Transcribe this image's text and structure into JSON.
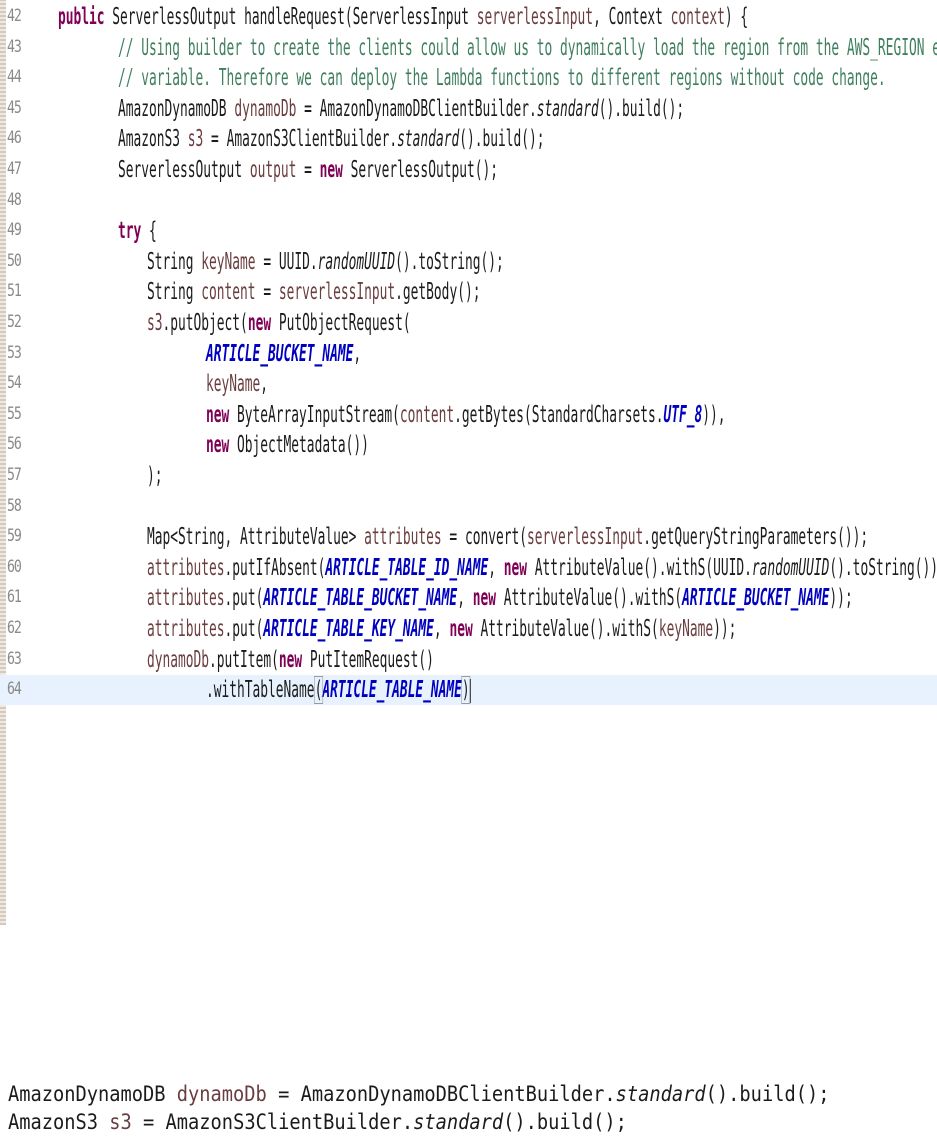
{
  "editor": {
    "lines": [
      {
        "num": "42",
        "tokens": [
          {
            "t": "public",
            "c": "kw"
          },
          {
            "t": " ServerlessOutput handleRequest(ServerlessInput "
          },
          {
            "t": "serverlessInput",
            "c": "var"
          },
          {
            "t": ", Context "
          },
          {
            "t": "context",
            "c": "var"
          },
          {
            "t": ") {"
          }
        ]
      },
      {
        "num": "43",
        "tokens": [
          {
            "t": "// Using builder to create the clients could allow us to dynamically load the region from the AWS_REGION envi",
            "c": "cm"
          }
        ]
      },
      {
        "num": "44",
        "tokens": [
          {
            "t": "// variable. Therefore we can deploy the Lambda functions to different regions without code change.",
            "c": "cm"
          }
        ]
      },
      {
        "num": "45",
        "tokens": [
          {
            "t": "AmazonDynamoDB "
          },
          {
            "t": "dynamoDb",
            "c": "var"
          },
          {
            "t": " = AmazonDynamoDBClientBuilder."
          },
          {
            "t": "standard",
            "c": "it"
          },
          {
            "t": "().build();"
          }
        ]
      },
      {
        "num": "46",
        "tokens": [
          {
            "t": "AmazonS3 "
          },
          {
            "t": "s3",
            "c": "var"
          },
          {
            "t": " = AmazonS3ClientBuilder."
          },
          {
            "t": "standard",
            "c": "it"
          },
          {
            "t": "().build();"
          }
        ]
      },
      {
        "num": "47",
        "tokens": [
          {
            "t": "ServerlessOutput "
          },
          {
            "t": "output",
            "c": "var"
          },
          {
            "t": " = "
          },
          {
            "t": "new",
            "c": "kw"
          },
          {
            "t": " ServerlessOutput();"
          }
        ]
      },
      {
        "num": "48",
        "tokens": []
      },
      {
        "num": "49",
        "tokens": [
          {
            "t": "try",
            "c": "kw"
          },
          {
            "t": " {"
          }
        ]
      },
      {
        "num": "50",
        "tokens": [
          {
            "t": "String "
          },
          {
            "t": "keyName",
            "c": "var"
          },
          {
            "t": " = UUID."
          },
          {
            "t": "randomUUID",
            "c": "it"
          },
          {
            "t": "().toString();"
          }
        ]
      },
      {
        "num": "51",
        "tokens": [
          {
            "t": "String "
          },
          {
            "t": "content",
            "c": "var"
          },
          {
            "t": " = "
          },
          {
            "t": "serverlessInput",
            "c": "var"
          },
          {
            "t": ".getBody();"
          }
        ]
      },
      {
        "num": "52",
        "tokens": [
          {
            "t": "s3",
            "c": "var"
          },
          {
            "t": ".putObject("
          },
          {
            "t": "new",
            "c": "kw"
          },
          {
            "t": " PutObjectRequest("
          }
        ]
      },
      {
        "num": "53",
        "tokens": [
          {
            "t": "ARTICLE_BUCKET_NAME",
            "c": "fld"
          },
          {
            "t": ","
          }
        ]
      },
      {
        "num": "54",
        "tokens": [
          {
            "t": "keyName",
            "c": "var"
          },
          {
            "t": ","
          }
        ]
      },
      {
        "num": "55",
        "tokens": [
          {
            "t": "new",
            "c": "kw"
          },
          {
            "t": " ByteArrayInputStream("
          },
          {
            "t": "content",
            "c": "var"
          },
          {
            "t": ".getBytes(StandardCharsets."
          },
          {
            "t": "UTF_8",
            "c": "fld"
          },
          {
            "t": ")),"
          }
        ]
      },
      {
        "num": "56",
        "tokens": [
          {
            "t": "new",
            "c": "kw"
          },
          {
            "t": " ObjectMetadata())"
          }
        ]
      },
      {
        "num": "57",
        "tokens": [
          {
            "t": ");"
          }
        ]
      },
      {
        "num": "58",
        "tokens": []
      },
      {
        "num": "59",
        "tokens": [
          {
            "t": "Map<String, AttributeValue> "
          },
          {
            "t": "attributes",
            "c": "var"
          },
          {
            "t": " = convert("
          },
          {
            "t": "serverlessInput",
            "c": "var"
          },
          {
            "t": ".getQueryStringParameters());"
          }
        ]
      },
      {
        "num": "60",
        "tokens": [
          {
            "t": "attributes",
            "c": "var"
          },
          {
            "t": ".putIfAbsent("
          },
          {
            "t": "ARTICLE_TABLE_ID_NAME",
            "c": "fld"
          },
          {
            "t": ", "
          },
          {
            "t": "new",
            "c": "kw"
          },
          {
            "t": " AttributeValue().withS(UUID."
          },
          {
            "t": "randomUUID",
            "c": "it"
          },
          {
            "t": "().toString()));"
          }
        ]
      },
      {
        "num": "61",
        "tokens": [
          {
            "t": "attributes",
            "c": "var"
          },
          {
            "t": ".put("
          },
          {
            "t": "ARTICLE_TABLE_BUCKET_NAME",
            "c": "fld"
          },
          {
            "t": ", "
          },
          {
            "t": "new",
            "c": "kw"
          },
          {
            "t": " AttributeValue().withS("
          },
          {
            "t": "ARTICLE_BUCKET_NAME",
            "c": "fld"
          },
          {
            "t": "));"
          }
        ]
      },
      {
        "num": "62",
        "tokens": [
          {
            "t": "attributes",
            "c": "var"
          },
          {
            "t": ".put("
          },
          {
            "t": "ARTICLE_TABLE_KEY_NAME",
            "c": "fld"
          },
          {
            "t": ", "
          },
          {
            "t": "new",
            "c": "kw"
          },
          {
            "t": " AttributeValue().withS("
          },
          {
            "t": "keyName",
            "c": "var"
          },
          {
            "t": "));"
          }
        ]
      },
      {
        "num": "63",
        "tokens": [
          {
            "t": "dynamoDb",
            "c": "var"
          },
          {
            "t": ".putItem("
          },
          {
            "t": "new",
            "c": "kw"
          },
          {
            "t": " PutItemRequest()"
          }
        ]
      },
      {
        "num": "64",
        "tokens": [
          {
            "t": ".withTableName"
          },
          {
            "t": "(",
            "c": "bracket"
          },
          {
            "t": "ARTICLE_TABLE_NAME",
            "c": "fld"
          },
          {
            "t": ")",
            "c": "bracket"
          }
        ]
      }
    ]
  },
  "snippet": {
    "lines": [
      {
        "tokens": [
          {
            "t": "AmazonDynamoDB "
          },
          {
            "t": "dynamoDb",
            "c": "var"
          },
          {
            "t": " = AmazonDynamoDBClientBuilder."
          },
          {
            "t": "standard",
            "c": "it"
          },
          {
            "t": "().build();"
          }
        ]
      },
      {
        "tokens": [
          {
            "t": "AmazonS3 "
          },
          {
            "t": "s3",
            "c": "var"
          },
          {
            "t": " = AmazonS3ClientBuilder."
          },
          {
            "t": "standard",
            "c": "it"
          },
          {
            "t": "().build();"
          }
        ]
      }
    ]
  }
}
